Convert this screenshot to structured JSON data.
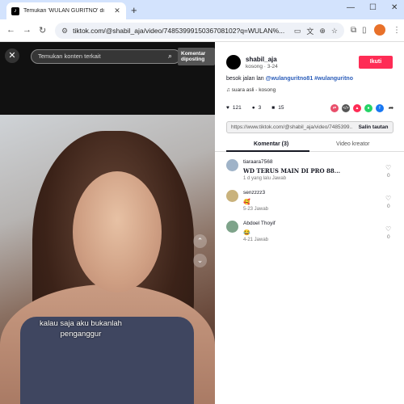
{
  "browser": {
    "tab_title": "Temukan 'WULAN GURITNO' di",
    "tab_favicon": "♪",
    "url": "tiktok.com/@shabil_aja/video/7485399915036708102?q=WULAN%..."
  },
  "video": {
    "search_placeholder": "Temukan konten terkait",
    "tooltip": "Komentar diposting",
    "caption_line1": "kalau saja aku bukanlah",
    "caption_line2": "penganggur"
  },
  "post": {
    "username": "shabil_aja",
    "subline": "kosong · 3-24",
    "follow_label": "Ikuti",
    "description_text": "besok jalan lan ",
    "description_tags": "@wulanguritno81 #wulanguritno",
    "music": "♫  suara asli - kosong",
    "likes": "121",
    "comments": "3",
    "saves": "15",
    "link": "https://www.tiktok.com/@shabil_aja/video/7485399...",
    "copy_label": "Salin tautan"
  },
  "tabs": {
    "comments": "Komentar (3)",
    "creator": "Video kreator"
  },
  "comments": [
    {
      "name": "tiaraara7568",
      "text": "WD TERUS MAIN DI PRO 88...",
      "meta": "1 d yang lalu    Jawab",
      "likes": "0"
    },
    {
      "name": "senzzzz3",
      "text": "🥰",
      "meta": "5-23    Jawab",
      "likes": "0"
    },
    {
      "name": "Abdoel Thoyif",
      "text": "😂",
      "meta": "4-21    Jawab",
      "likes": "0"
    }
  ],
  "colors": {
    "accent": "#fe2c55",
    "link": "#2b5db9"
  }
}
